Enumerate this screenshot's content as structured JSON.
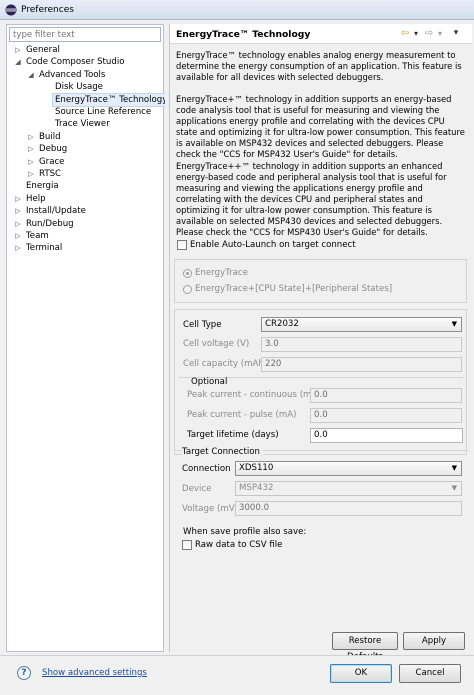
{
  "window": {
    "title": "Preferences"
  },
  "filter": {
    "placeholder": "type filter text"
  },
  "tree": [
    {
      "label": "General",
      "level": 0,
      "arrow": "▷"
    },
    {
      "label": "Code Composer Studio",
      "level": 0,
      "arrow": "◢"
    },
    {
      "label": "Advanced Tools",
      "level": 1,
      "arrow": "◢"
    },
    {
      "label": "Disk Usage",
      "level": 2,
      "arrow": ""
    },
    {
      "label": "EnergyTrace™ Technology",
      "level": 2,
      "arrow": "",
      "selected": true
    },
    {
      "label": "Source Line Reference",
      "level": 2,
      "arrow": ""
    },
    {
      "label": "Trace Viewer",
      "level": 2,
      "arrow": ""
    },
    {
      "label": "Build",
      "level": 1,
      "arrow": "▷"
    },
    {
      "label": "Debug",
      "level": 1,
      "arrow": "▷"
    },
    {
      "label": "Grace",
      "level": 1,
      "arrow": "▷"
    },
    {
      "label": "RTSC",
      "level": 1,
      "arrow": "▷"
    },
    {
      "label": "Energia",
      "level": 0,
      "arrow": ""
    },
    {
      "label": "Help",
      "level": 0,
      "arrow": "▷"
    },
    {
      "label": "Install/Update",
      "level": 0,
      "arrow": "▷"
    },
    {
      "label": "Run/Debug",
      "level": 0,
      "arrow": "▷"
    },
    {
      "label": "Team",
      "level": 0,
      "arrow": "▷"
    },
    {
      "label": "Terminal",
      "level": 0,
      "arrow": "▷"
    }
  ],
  "page": {
    "title": "EnergyTrace™ Technology",
    "nav": {
      "back": "⇦",
      "back_dd": "▾",
      "forward": "⇨",
      "forward_dd": "▾",
      "menu": "▾"
    },
    "desc1": "EnergyTrace™ technology enables analog energy measurement to determine the energy consumption of an application. This feature is available for all devices with selected debuggers.",
    "desc2": "EnergyTrace+™ technology in addition supports an energy-based code analysis tool that is useful for measuring and viewing the applications energy profile and correlating with the devices CPU state and optimizing it for ultra-low power consumption. This feature is available on MSP432 devices and selected debuggers. Please check the \"CCS for MSP432 User's Guide\" for details.",
    "desc3": "EnergyTrace++™ technology in addition supports an enhanced energy-based code and peripheral analysis tool that is useful for measuring and viewing the applications energy profile and correlating with the devices CPU and peripheral states and optimizing it for ultra-low power consumption. This feature is available on selected MSP430 devices and selected debuggers. Please check the \"CCS for MSP430 User's Guide\" for details.",
    "auto_launch": "Enable Auto-Launch on target connect",
    "mode_options": [
      "EnergyTrace",
      "EnergyTrace+[CPU State]+[Peripheral States]"
    ],
    "cell_type_label": "Cell Type",
    "cell_type_value": "CR2032",
    "cell_voltage_label": "Cell voltage (V)",
    "cell_voltage_value": "3.0",
    "cell_capacity_label": "Cell capacity (mAh)",
    "cell_capacity_value": "220",
    "optional_label": "Optional",
    "peak_cont_label": "Peak current - continuous (mA)",
    "peak_cont_value": "0.0",
    "peak_pulse_label": "Peak current - pulse (mA)",
    "peak_pulse_value": "0.0",
    "lifetime_label": "Target lifetime (days)",
    "lifetime_value": "0.0",
    "target_conn_label": "Target Connection",
    "connection_label": "Connection",
    "connection_value": "XDS110",
    "device_label": "Device",
    "device_value": "MSP432",
    "voltage_label": "Voltage (mV)",
    "voltage_value": "3000.0",
    "save_profile_label": "When save profile also save:",
    "raw_csv_label": "Raw data to CSV file",
    "restore_defaults": "Restore Defaults",
    "apply": "Apply"
  },
  "bottom": {
    "help_icon": "?",
    "advanced_link": "Show advanced settings",
    "ok": "OK",
    "cancel": "Cancel"
  },
  "colors": {
    "accent": "#3c7fb1",
    "link": "#1a4c9c",
    "selection": "#e3edf9"
  }
}
